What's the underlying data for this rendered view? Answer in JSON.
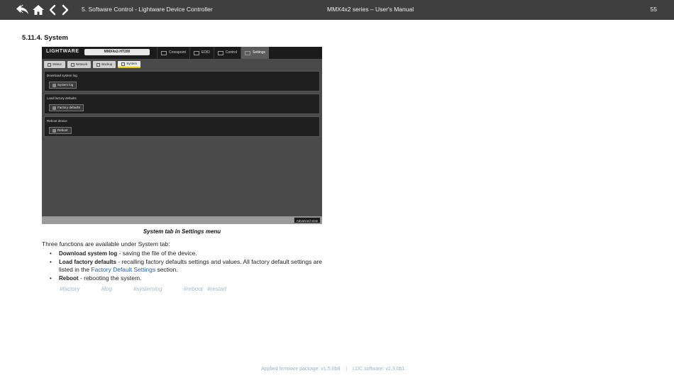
{
  "header": {
    "chapter_title": "5. Software Control - Lightware Device Controller",
    "manual_title": "MMX4x2 series – User's Manual",
    "page_number": "55",
    "icons": [
      "back-history-icon",
      "home-icon",
      "previous-page-icon",
      "next-page-icon"
    ]
  },
  "section": {
    "heading": "5.11.4. System"
  },
  "screenshot": {
    "logo_text": "LIGHTWARE",
    "device_name": "MMX4x2-HT200",
    "menu_tabs": [
      "Crosspoint",
      "EDID",
      "Control",
      "Settings"
    ],
    "active_menu_tab": "Settings",
    "sub_tabs": [
      "Status",
      "Network",
      "Backup",
      "System"
    ],
    "active_sub_tab": "System",
    "panels": [
      {
        "label": "Download system log",
        "button": "System log"
      },
      {
        "label": "Load factory defaults",
        "button": "Factory defaults"
      },
      {
        "label": "Reboot device",
        "button": "Reboot"
      }
    ],
    "advanced_view_label": "Advanced view"
  },
  "caption": "System tab in Settings menu",
  "intro": "Three functions are available under System tab:",
  "bullets": {
    "b1_strong": "Download system log",
    "b1_text": " - saving the file of the device.",
    "b2_strong": "Load factory defaults",
    "b2_text": " - recalling factory defaults settings and values. All factory default settings are listed in the ",
    "b2_link": "Factory Default Settings",
    "b2_after": " section.",
    "b3_strong": "Reboot",
    "b3_text": " - rebooting the system."
  },
  "tags": [
    "#factory",
    "#log",
    "#systemlog",
    "#reboot",
    "#restart"
  ],
  "footer": {
    "firmware": "Applied firmware package: v1.5.0b8",
    "separator": "|",
    "software": "LDC software: v2.3.0b1"
  }
}
